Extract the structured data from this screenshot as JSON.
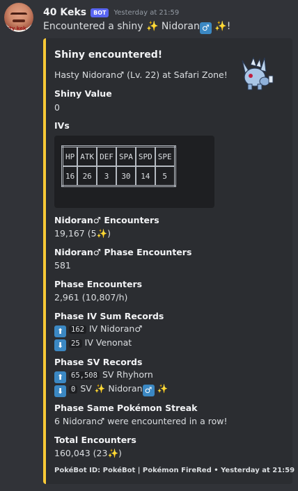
{
  "message": {
    "username": "40 Keks",
    "bot_badge": "BOT",
    "timestamp": "Yesterday at 21:59",
    "avatar_text": "rty kek",
    "content_prefix": "Encountered a shiny",
    "content_pokemon": "Nidoran",
    "content_suffix": "!",
    "sparkle": "✨",
    "male_symbol": "♂"
  },
  "embed": {
    "accent_color": "#f8c936",
    "title": "Shiny encountered!",
    "description": "Hasty Nidoran♂ (Lv. 22) at Safari Zone!",
    "thumbnail_icon": "nidoran-male-shiny-sprite",
    "fields": {
      "shiny_value": {
        "name": "Shiny Value",
        "value": "0"
      },
      "ivs": {
        "name": "IVs",
        "headers": [
          "HP",
          "ATK",
          "DEF",
          "SPA",
          "SPD",
          "SPE"
        ],
        "values": [
          "16",
          "26",
          "3",
          "30",
          "14",
          "5"
        ]
      },
      "encounters": {
        "name": "Nidoran♂ Encounters",
        "value": "19,167 (5",
        "value_end": ")"
      },
      "phase_species": {
        "name": "Nidoran♂ Phase Encounters",
        "value": "581"
      },
      "phase_encounters": {
        "name": "Phase Encounters",
        "value": "2,961 (10,807/h)"
      },
      "iv_records": {
        "name": "Phase IV Sum Records",
        "high_code": "162",
        "high_text": "IV Nidoran♂",
        "low_code": "25",
        "low_text": "IV Venonat"
      },
      "sv_records": {
        "name": "Phase SV Records",
        "high_code": "65,508",
        "high_text": "SV Rhyhorn",
        "low_code": "0",
        "low_text_prefix": "SV",
        "low_text_pokemon": "Nidoran"
      },
      "streak": {
        "name": "Phase Same Pokémon Streak",
        "value": "6 Nidoran♂ were encountered in a row!"
      },
      "total": {
        "name": "Total Encounters",
        "value": "160,043 (23",
        "value_end": ")"
      }
    },
    "arrow_up": "⬆",
    "arrow_down": "⬇",
    "footer": "PokéBot ID: PokéBot | Pokémon FireRed • Yesterday at 21:59"
  }
}
